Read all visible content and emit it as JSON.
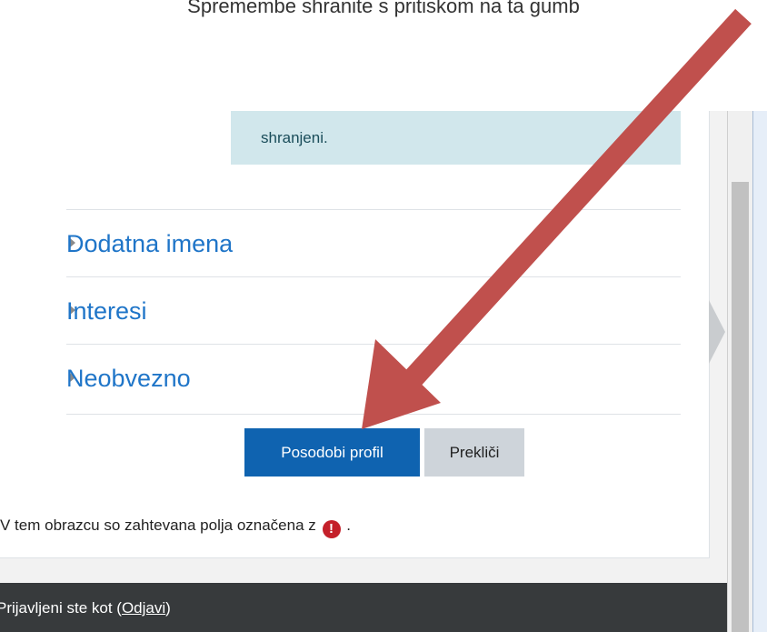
{
  "instruction": "Spremembe shranite s pritiskom na ta gumb",
  "info_box": {
    "text": "shranjeni."
  },
  "sections": [
    {
      "label": "Dodatna imena"
    },
    {
      "label": "Interesi"
    },
    {
      "label": "Neobvezno"
    }
  ],
  "buttons": {
    "update_profile": "Posodobi profil",
    "cancel": "Prekliči"
  },
  "required_note": {
    "prefix": "V tem obrazcu so zahtevana polja označena z",
    "icon": "!",
    "suffix": "."
  },
  "footer": {
    "logged_in_text": "Prijavljeni ste kot",
    "logout_link": "Odjavi"
  },
  "colors": {
    "link": "#1f75c8",
    "primary_button": "#0f63b0",
    "info_bg": "#d1e7ec",
    "footer_bg": "#373a3c",
    "arrow": "#c0504d"
  }
}
